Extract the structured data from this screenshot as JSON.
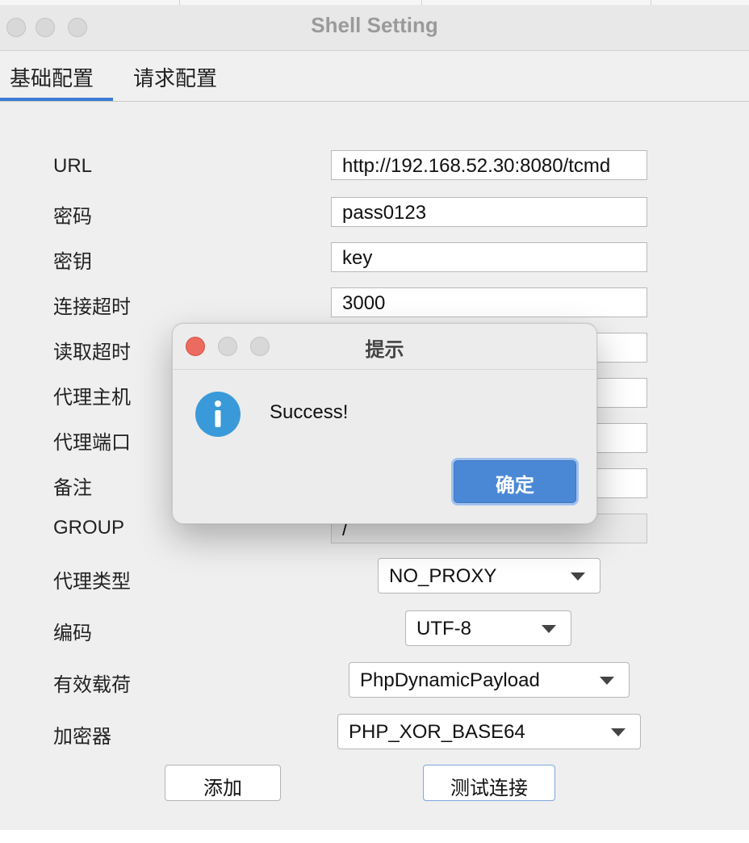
{
  "window": {
    "title": "Shell Setting"
  },
  "tabs": [
    {
      "label": "基础配置",
      "active": true
    },
    {
      "label": "请求配置",
      "active": false
    }
  ],
  "form": {
    "url": {
      "label": "URL",
      "value": "http://192.168.52.30:8080/tcmd"
    },
    "password": {
      "label": "密码",
      "value": "pass0123"
    },
    "key": {
      "label": "密钥",
      "value": "key"
    },
    "connect_timeout": {
      "label": "连接超时",
      "value": "3000"
    },
    "read_timeout": {
      "label": "读取超时",
      "value": ""
    },
    "proxy_host": {
      "label": "代理主机",
      "value": ""
    },
    "proxy_port": {
      "label": "代理端口",
      "value": ""
    },
    "remark": {
      "label": "备注",
      "value": ""
    },
    "group": {
      "label": "GROUP",
      "value": "/"
    },
    "proxy_type": {
      "label": "代理类型",
      "value": "NO_PROXY"
    },
    "encoding": {
      "label": "编码",
      "value": "UTF-8"
    },
    "payload": {
      "label": "有效载荷",
      "value": "PhpDynamicPayload"
    },
    "cryption": {
      "label": "加密器",
      "value": "PHP_XOR_BASE64"
    }
  },
  "buttons": {
    "add": "添加",
    "test": "测试连接"
  },
  "dialog": {
    "title": "提示",
    "message": "Success!",
    "ok": "确定",
    "icon": "info-icon"
  },
  "colors": {
    "accent": "#3b7bd4",
    "dialog_button": "#4a88d6",
    "info_icon": "#3a9ad9",
    "close_light": "#ec6a5e"
  }
}
